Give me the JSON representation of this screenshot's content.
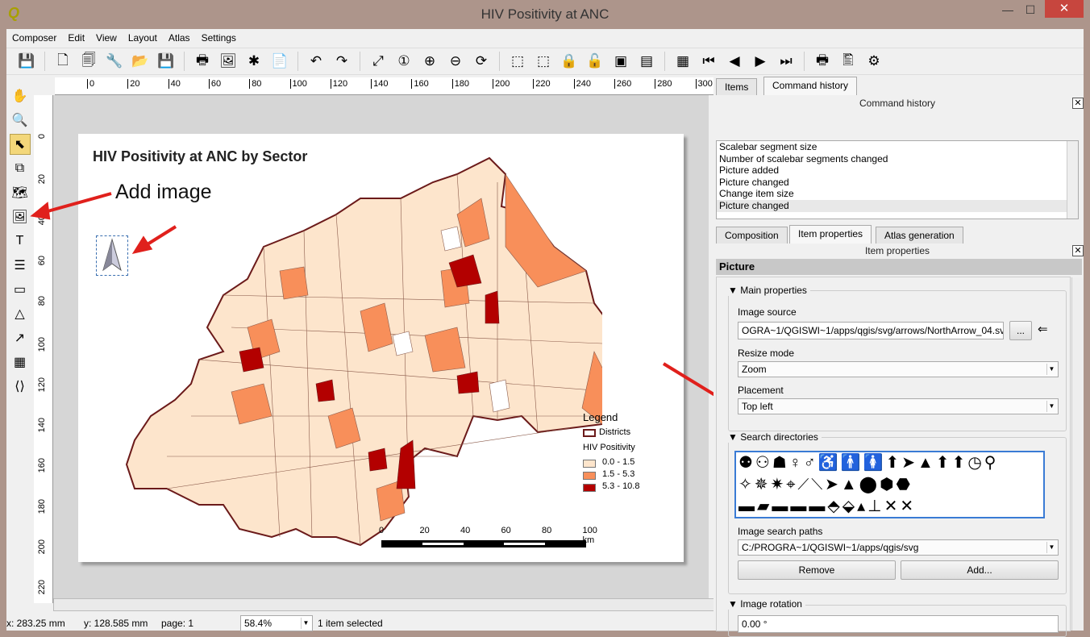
{
  "window": {
    "title": "HIV Positivity at ANC",
    "minimize": "—",
    "maximize": "☐",
    "close": "✕"
  },
  "menu": [
    "Composer",
    "Edit",
    "View",
    "Layout",
    "Atlas",
    "Settings"
  ],
  "toolbar_icons": [
    "save-icon",
    "new-composer-icon",
    "duplicate-composer-icon",
    "composer-manager-icon",
    "open-template-icon",
    "save-template-icon",
    "print-icon",
    "export-image-icon",
    "export-svg-icon",
    "export-pdf-icon",
    "undo-icon",
    "redo-icon",
    "zoom-full-icon",
    "zoom-100-icon",
    "zoom-in-icon",
    "zoom-out-icon",
    "refresh-icon",
    "select-all-icon",
    "deselect-icon",
    "lock-icon",
    "unlock-icon",
    "group-icon",
    "align-icon",
    "atlas-preview-icon",
    "first-feature-icon",
    "previous-feature-icon",
    "next-feature-icon",
    "last-feature-icon",
    "atlas-print-icon",
    "atlas-export-icon",
    "atlas-settings-icon"
  ],
  "left_tools": [
    "pan-icon",
    "zoom-tool-icon",
    "select-move-icon",
    "move-content-icon",
    "add-map-icon",
    "add-image-icon",
    "add-label-icon",
    "add-legend-icon",
    "add-scalebar-icon",
    "add-shape-icon",
    "add-arrow-icon",
    "add-table-icon",
    "add-html-icon"
  ],
  "ruler_h": [
    "0",
    "20",
    "40",
    "60",
    "80",
    "100",
    "120",
    "140",
    "160",
    "180",
    "200",
    "220",
    "240",
    "260",
    "280",
    "300"
  ],
  "ruler_v": [
    "0",
    "20",
    "40",
    "60",
    "80",
    "100",
    "120",
    "140",
    "160",
    "180",
    "200",
    "220"
  ],
  "map": {
    "title": "HIV Positivity at ANC by Sector",
    "legend": {
      "title": "Legend",
      "districts": "Districts",
      "layer": "HIV Positivity",
      "classes": [
        {
          "label": "0.0 - 1.5",
          "color": "#fde5cc"
        },
        {
          "label": "1.5 - 5.3",
          "color": "#f88f5a"
        },
        {
          "label": "5.3 - 10.8",
          "color": "#b30000"
        }
      ]
    },
    "scalebar": {
      "labels": [
        "0",
        "20",
        "40",
        "60",
        "80",
        "100 km"
      ]
    }
  },
  "annotation": {
    "add_image": "Add image"
  },
  "status": {
    "x": "x: 283.25 mm",
    "y": "y: 128.585 mm",
    "page": "page: 1",
    "zoom": "58.4%",
    "selection": "1 item selected"
  },
  "panel": {
    "top_tabs": [
      "Items",
      "Command history"
    ],
    "command_history_title": "Command history",
    "commands": [
      "Scalebar segment size",
      "Number of scalebar segments changed",
      "Picture added",
      "Picture changed",
      "Change item size",
      "Picture changed"
    ],
    "bottom_tabs": [
      "Composition",
      "Item properties",
      "Atlas generation"
    ],
    "item_properties_title": "Item properties",
    "section": "Picture",
    "main_properties": "Main properties",
    "image_source_label": "Image source",
    "image_source": "OGRA~1/QGISWI~1/apps/qgis/svg/arrows/NorthArrow_04.svg",
    "browse": "...",
    "resize_mode_label": "Resize mode",
    "resize_mode": "Zoom",
    "placement_label": "Placement",
    "placement": "Top left",
    "search_directories": "Search directories",
    "svg_icons": "⚉⚇☗♀♂♿🚹🚺⬆➤▲⬆⬆◷⚲ ✧✵✷⌖⟋⟍➤▲⬤⬢⬣ ▬▰▬▬▬⬘⬙▴⊥✕✕",
    "search_paths_label": "Image search paths",
    "search_path": "C:/PROGRA~1/QGISWI~1/apps/qgis/svg",
    "remove": "Remove",
    "add": "Add...",
    "image_rotation": "Image rotation",
    "rotation": "0.00 °"
  }
}
